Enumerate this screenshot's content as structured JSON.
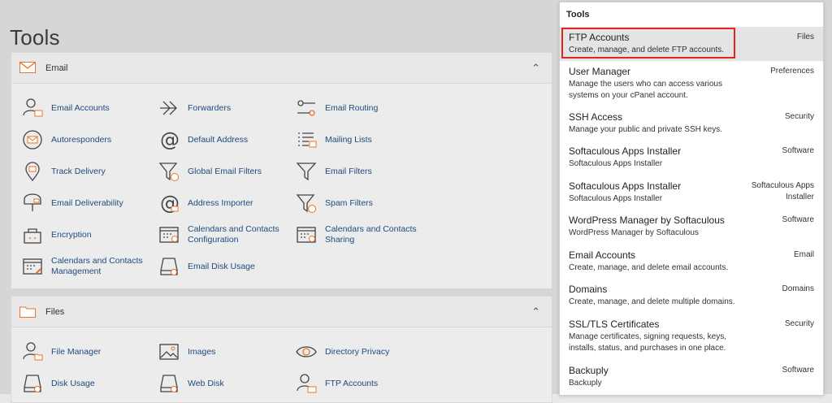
{
  "page": {
    "title": "Tools"
  },
  "email_section": {
    "title": "Email",
    "tools": [
      {
        "label": "Email Accounts",
        "icon": "email-accounts-icon"
      },
      {
        "label": "Forwarders",
        "icon": "forwarders-icon"
      },
      {
        "label": "Email Routing",
        "icon": "email-routing-icon"
      },
      {
        "label": "Autoresponders",
        "icon": "autoresponders-icon"
      },
      {
        "label": "Default Address",
        "icon": "default-address-icon"
      },
      {
        "label": "Mailing Lists",
        "icon": "mailing-lists-icon"
      },
      {
        "label": "Track Delivery",
        "icon": "track-delivery-icon"
      },
      {
        "label": "Global Email Filters",
        "icon": "global-email-filters-icon"
      },
      {
        "label": "Email Filters",
        "icon": "email-filters-icon"
      },
      {
        "label": "Email Deliverability",
        "icon": "email-deliverability-icon"
      },
      {
        "label": "Address Importer",
        "icon": "address-importer-icon"
      },
      {
        "label": "Spam Filters",
        "icon": "spam-filters-icon"
      },
      {
        "label": "Encryption",
        "icon": "encryption-icon"
      },
      {
        "label": "Calendars and Contacts Configuration",
        "icon": "calendar-config-icon"
      },
      {
        "label": "Calendars and Contacts Sharing",
        "icon": "calendar-sharing-icon"
      },
      {
        "label": "Calendars and Contacts Management",
        "icon": "calendar-management-icon"
      },
      {
        "label": "Email Disk Usage",
        "icon": "email-disk-usage-icon"
      }
    ]
  },
  "files_section": {
    "title": "Files",
    "tools": [
      {
        "label": "File Manager",
        "icon": "file-manager-icon"
      },
      {
        "label": "Images",
        "icon": "images-icon"
      },
      {
        "label": "Directory Privacy",
        "icon": "directory-privacy-icon"
      },
      {
        "label": "Disk Usage",
        "icon": "disk-usage-icon"
      },
      {
        "label": "Web Disk",
        "icon": "web-disk-icon"
      },
      {
        "label": "FTP Accounts",
        "icon": "ftp-accounts-icon"
      }
    ]
  },
  "dropdown": {
    "header": "Tools",
    "items": [
      {
        "title": "FTP Accounts",
        "desc": "Create, manage, and delete FTP accounts.",
        "category": "Files"
      },
      {
        "title": "User Manager",
        "desc": "Manage the users who can access various systems on your cPanel account.",
        "category": "Preferences"
      },
      {
        "title": "SSH Access",
        "desc": "Manage your public and private SSH keys.",
        "category": "Security"
      },
      {
        "title": "Softaculous Apps Installer",
        "desc": "Softaculous Apps Installer",
        "category": "Software"
      },
      {
        "title": "Softaculous Apps Installer",
        "desc": "Softaculous Apps Installer",
        "category": "Softaculous Apps Installer"
      },
      {
        "title": "WordPress Manager by Softaculous",
        "desc": "WordPress Manager by Softaculous",
        "category": "Software"
      },
      {
        "title": "Email Accounts",
        "desc": "Create, manage, and delete email accounts.",
        "category": "Email"
      },
      {
        "title": "Domains",
        "desc": "Create, manage, and delete multiple domains.",
        "category": "Domains"
      },
      {
        "title": "SSL/TLS Certificates",
        "desc": "Manage certificates, signing requests, keys, installs, status, and purchases in one place.",
        "category": "Security"
      },
      {
        "title": "Backuply",
        "desc": "Backuply",
        "category": "Software"
      }
    ]
  },
  "colors": {
    "accent_orange": "#e8742a",
    "link_blue": "#1f4a7d",
    "highlight_red": "#e0261c"
  }
}
